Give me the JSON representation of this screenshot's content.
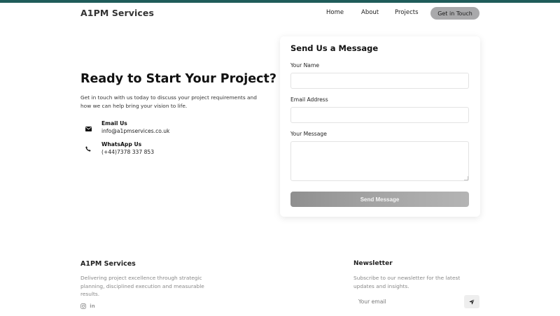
{
  "header": {
    "brand": "A1PM Services",
    "nav": {
      "home": "Home",
      "about": "About",
      "projects": "Projects"
    },
    "cta_label": "Get in Touch",
    "accent_color": "#1f5c5a"
  },
  "contact": {
    "heading": "Ready to Start Your Project?",
    "intro": "Get in touch with us today to discuss your project requirements and how we can help bring your vision to life.",
    "email": {
      "title": "Email Us",
      "value": "info@a1pmservices.co.uk",
      "icon": "envelope-icon"
    },
    "whatsapp": {
      "title": "WhatsApp Us",
      "value": "(+44)7378 337 853",
      "icon": "phone-icon"
    }
  },
  "form": {
    "title": "Send Us a Message",
    "name_label": "Your Name",
    "name_value": "",
    "email_label": "Email Address",
    "email_value": "",
    "message_label": "Your Message",
    "message_value": "",
    "submit_label": "Send Message"
  },
  "footer": {
    "brand": "A1PM Services",
    "description": "Delivering project excellence through strategic planning, disciplined execution and measurable results.",
    "social": {
      "instagram_icon": "instagram-icon",
      "linkedin_icon": "linkedin-icon"
    },
    "newsletter": {
      "title": "Newsletter",
      "description": "Subscribe to our newsletter for the latest updates and insights.",
      "placeholder": "Your email",
      "submit_icon": "send-icon"
    }
  }
}
